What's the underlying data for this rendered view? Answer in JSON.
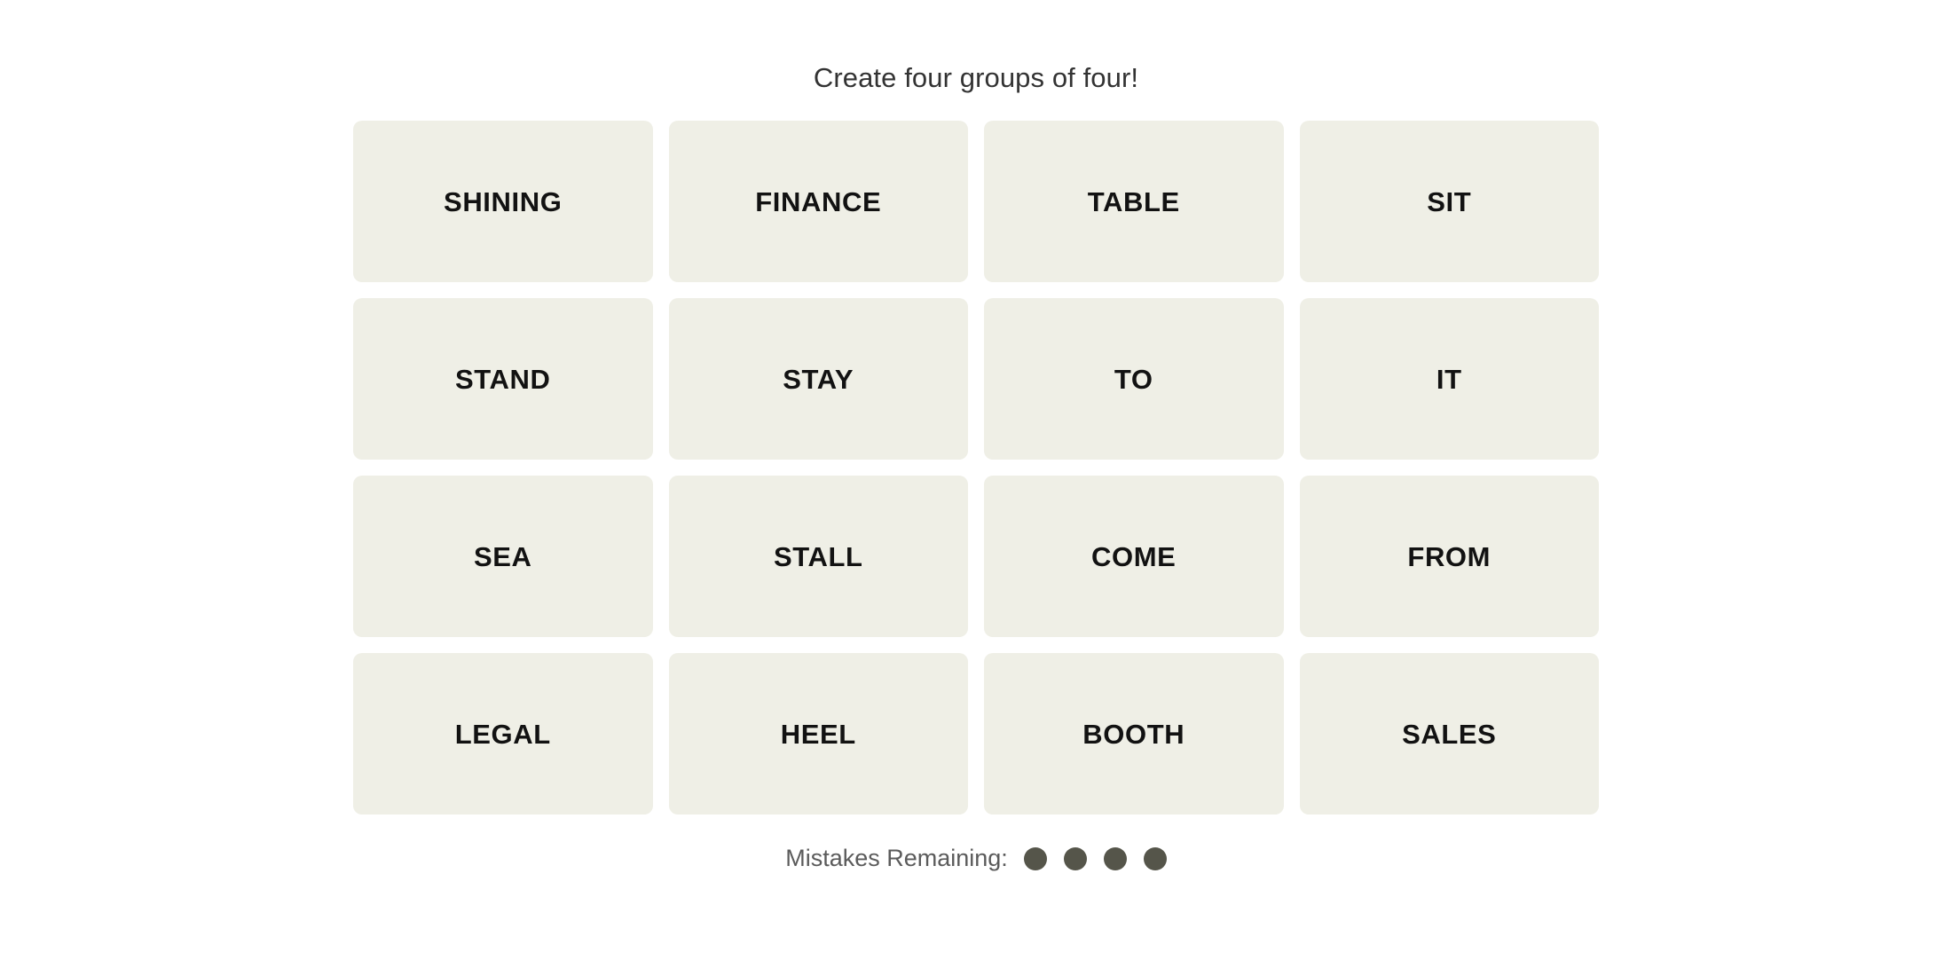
{
  "game": {
    "title": "Create four groups of four!",
    "tiles": [
      {
        "label": "SHINING"
      },
      {
        "label": "FINANCE"
      },
      {
        "label": "TABLE"
      },
      {
        "label": "SIT"
      },
      {
        "label": "STAND"
      },
      {
        "label": "STAY"
      },
      {
        "label": "TO"
      },
      {
        "label": "IT"
      },
      {
        "label": "SEA"
      },
      {
        "label": "STALL"
      },
      {
        "label": "COME"
      },
      {
        "label": "FROM"
      },
      {
        "label": "LEGAL"
      },
      {
        "label": "HEEL"
      },
      {
        "label": "BOOTH"
      },
      {
        "label": "SALES"
      }
    ],
    "mistakes": {
      "label": "Mistakes Remaining:",
      "remaining": 4,
      "dot_color": "#55554a"
    },
    "colors": {
      "page_background": "#ffffff",
      "tile_background": "#efefe6",
      "tile_text": "#121212",
      "title_text": "#333333",
      "mistakes_text": "#5b5b5b"
    }
  }
}
